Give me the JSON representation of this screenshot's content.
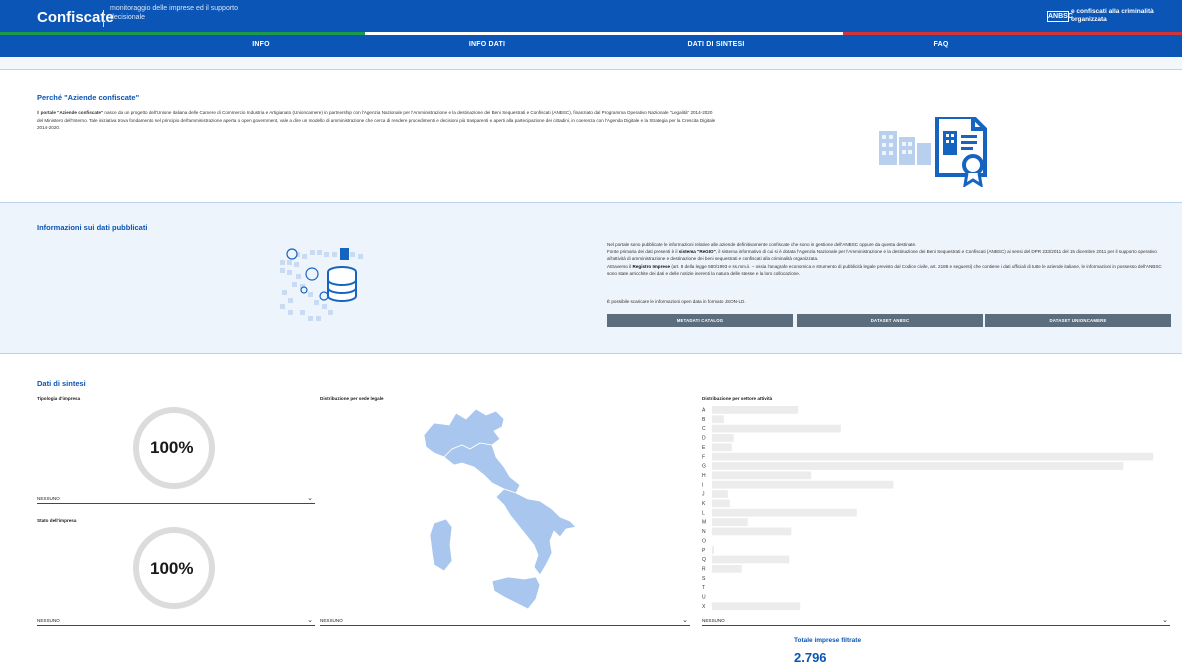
{
  "header": {
    "brand": "Confiscate",
    "brand_sub": "monitoraggio delle imprese ed il supporto decisionale",
    "gov_logo": "ANBSC",
    "gov_text": "e confiscati alla criminalità organizzata"
  },
  "nav": {
    "items": [
      {
        "label": "INFO"
      },
      {
        "label": "INFO DATI"
      },
      {
        "label": "DATI DI SINTESI"
      },
      {
        "label": "FAQ"
      }
    ]
  },
  "why": {
    "title": "Perché \"Aziende confiscate\"",
    "intro": "Il ",
    "bold": "portale \"Aziende confiscate\"",
    "text": " nasce da un progetto dell'Unione italiana delle Camere di Commercio Industria e Artigianato (Unioncamere) in partnership con l'Agenzia Nazionale per l'Amministrazione e la destinazione dei Beni Sequestrati e Confiscati (ANBSC), finanziato dal Programma Operativo Nazionale \"Legalità\" 2014-2020 del Ministero dell'Interno. Tale iniziativa trova fondamento nel principio dell'amministrazione aperta o open government, vale a dire un modello di amministrazione che cerca di rendere procedimenti e decisioni più trasparenti e aperti alla partecipazione dei cittadini, in coerenza con l'Agenda Digitale e la Strategia per la Crescita Digitale 2014-2020."
  },
  "info": {
    "title": "Informazioni sui dati pubblicati",
    "p1": "Nel portale sono pubblicate le informazioni relative alle aziende definitivamente confiscate che sono in gestione dell'ANBSC oppure da questa destinate.",
    "p2a": "Fonte primaria dei dati presenti è il ",
    "p2b": "sistema \"ReGIO\"",
    "p2c": ", il sistema informativo di cui si è dotata l'Agenzia Nazionale per l'Amministrazione e la destinazione dei Beni Sequestrati e Confiscati (ANBSC) ai sensi del DPR 233/2011 del 15 dicembre 2011 per il supporto operativo all'attività di amministrazione e destinazione dei beni sequestrati e confiscati alla criminalità organizzata.",
    "p3a": "Attraverso il ",
    "p3b": "Registro Imprese",
    "p3c": " (art. 8 della legge 580/1993 e ss.mm.ii. – ossia l'anagrafe economica e strumento di pubblicità legale previsto dal Codice civile, art. 2188 e seguenti) che contiene i dati ufficiali di tutte le aziende italiane, le informazioni in possesso dell'ANBSC sono state arricchite dei dati e delle notizie inerenti la natura delle stesse e la loro collocazione.",
    "json_note": "È possibile scaricare le informazioni open data in formato JSON-LD.",
    "buttons": [
      {
        "label": "METADATI CATALOG"
      },
      {
        "label": "DATASET ANBSC"
      },
      {
        "label": "DATASET UNIONCAMERE"
      }
    ]
  },
  "sintesi": {
    "title": "Dati di sintesi",
    "tipologia": {
      "label": "Tipologia d'impresa",
      "value": "100%",
      "select": "NESSUNO"
    },
    "stato": {
      "label": "Stato dell'impresa",
      "value": "100%",
      "select": "NESSUNO"
    },
    "sede": {
      "label": "Distribuzione per sede legale",
      "select": "NESSUNO"
    },
    "settore": {
      "label": "Distribuzione per settore attività",
      "select": "NESSUNO"
    },
    "total_label": "Totale imprese filtrate",
    "total_value": "2.796"
  },
  "chart_data": {
    "type": "bar",
    "orientation": "horizontal",
    "categories": [
      "A",
      "B",
      "C",
      "D",
      "E",
      "F",
      "G",
      "H",
      "I",
      "J",
      "K",
      "L",
      "M",
      "N",
      "O",
      "P",
      "Q",
      "R",
      "S",
      "T",
      "U",
      "X"
    ],
    "values": [
      87,
      12,
      130,
      22,
      20,
      445,
      415,
      100,
      183,
      16,
      18,
      146,
      36,
      80,
      0,
      2,
      78,
      30,
      0,
      0,
      0,
      89
    ],
    "xlim": [
      0,
      460
    ],
    "colors": {
      "bar": "#ececec"
    }
  },
  "colors": {
    "accent": "#0a55b5",
    "button": "#5c6d7e",
    "map_fill": "#a9c7ee",
    "donut": "#dcdcdc"
  }
}
